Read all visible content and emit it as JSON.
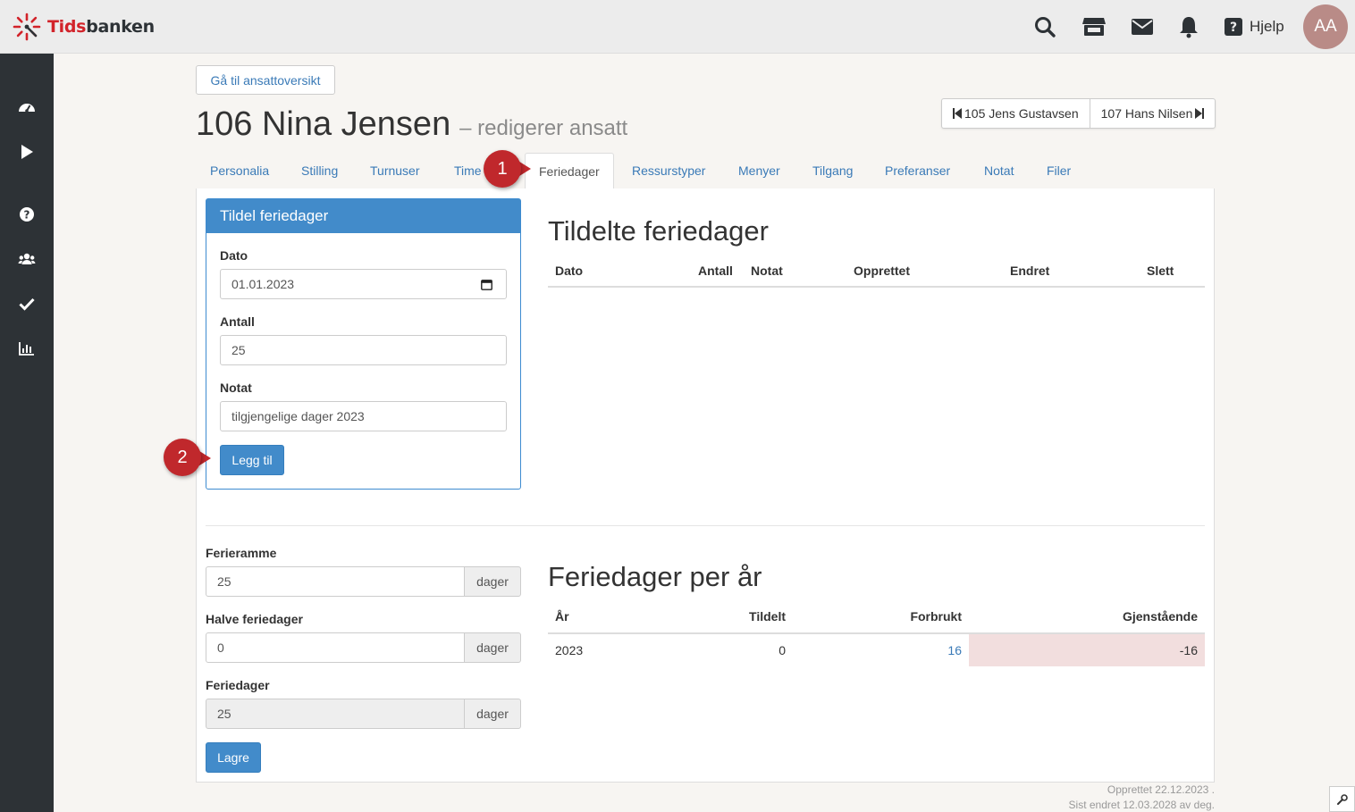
{
  "brand": {
    "part1": "Tids",
    "part2": "banken"
  },
  "header": {
    "help_label": "Hjelp",
    "avatar_initials": "AA",
    "icons": [
      "search-icon",
      "store-icon",
      "envelope-icon",
      "bell-icon",
      "question-icon"
    ]
  },
  "sidebar": {
    "icons": [
      "dashboard-icon",
      "play-icon",
      "question-circle-icon",
      "users-icon",
      "check-icon",
      "bar-chart-icon"
    ]
  },
  "back_button": "Gå til ansattoversikt",
  "title": {
    "main": "106 Nina Jensen",
    "sub": "– redigerer ansatt"
  },
  "employee_nav": {
    "prev": "105 Jens Gustavsen",
    "next": "107 Hans Nilsen"
  },
  "tabs": [
    "Personalia",
    "Stilling",
    "Turnuser",
    "Time",
    "Feriedager",
    "Ressurstyper",
    "Menyer",
    "Tilgang",
    "Preferanser",
    "Notat",
    "Filer"
  ],
  "active_tab": "Feriedager",
  "assign_form": {
    "heading": "Tildel feriedager",
    "date_label": "Dato",
    "date_value": "01.01.2023",
    "count_label": "Antall",
    "count_value": "25",
    "note_label": "Notat",
    "note_value": "tilgjengelige dager 2023",
    "submit_label": "Legg til"
  },
  "assigned_table": {
    "heading": "Tildelte feriedager",
    "columns": [
      "Dato",
      "Antall",
      "Notat",
      "Opprettet",
      "Endret",
      "Slett"
    ],
    "rows": []
  },
  "settings_form": {
    "frame_label": "Ferieramme",
    "frame_value": "25",
    "half_label": "Halve feriedager",
    "half_value": "0",
    "days_label": "Feriedager",
    "days_value": "25",
    "unit": "dager",
    "save_label": "Lagre"
  },
  "per_year_table": {
    "heading": "Feriedager per år",
    "columns": [
      "År",
      "Tildelt",
      "Forbrukt",
      "Gjenstående"
    ],
    "rows": [
      {
        "year": "2023",
        "assigned": "0",
        "used": "16",
        "remaining": "-16"
      }
    ]
  },
  "callouts": {
    "one": "1",
    "two": "2"
  },
  "meta": {
    "created": "Opprettet 22.12.2023 .",
    "modified": "Sist endret 12.03.2028 av deg."
  },
  "colors": {
    "primary": "#428bca",
    "sidebar": "#2d3236",
    "brand_red": "#d2232a",
    "badge": "#c0282c",
    "negative_bg": "#f2dede"
  }
}
